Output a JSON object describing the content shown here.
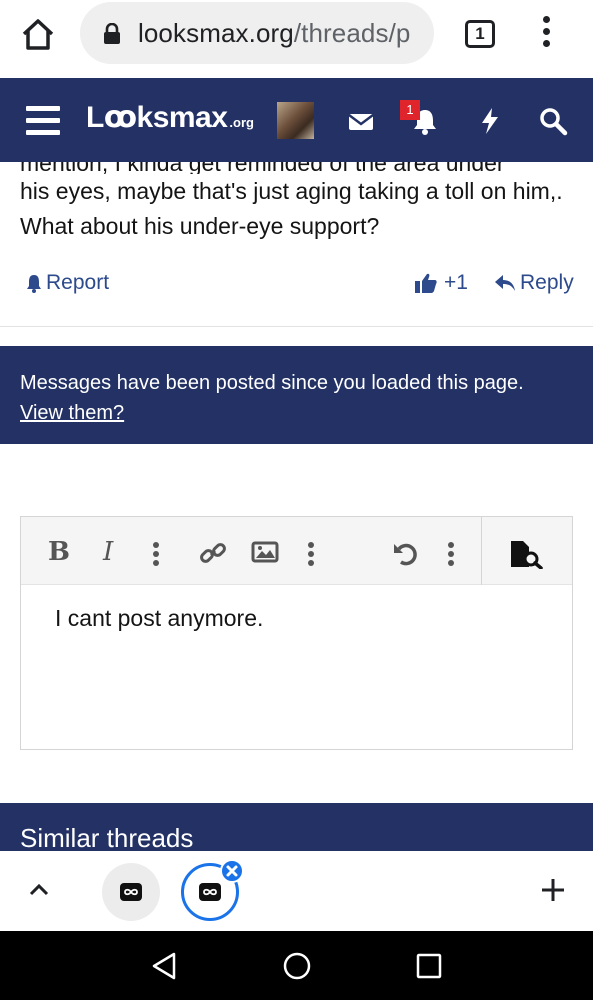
{
  "browser": {
    "url_host": "looksmax.org",
    "url_path": "/threads/p",
    "tab_count": "1",
    "icons": [
      "home-icon",
      "lock-icon",
      "tab-switcher-icon",
      "more-vert-icon"
    ]
  },
  "header": {
    "logo_main": "Lꝏksmax",
    "logo_tld": ".org",
    "notification_count": "1",
    "icons": [
      "menu-icon",
      "avatar",
      "mail-icon",
      "bell-icon",
      "bolt-icon",
      "search-icon"
    ]
  },
  "post": {
    "cut_off_line": "mention, I kinda get reminded of the area under",
    "text": "his eyes, maybe that's just aging taking a toll on him,. What about his under-eye support?",
    "report_label": "Report",
    "like_count": "+1",
    "reply_label": "Reply"
  },
  "notice": {
    "message": "Messages have been posted since you loaded this page.",
    "link": "View them?"
  },
  "editor": {
    "bold": "B",
    "italic": "I",
    "content": "I cant post anymore."
  },
  "similar": {
    "heading": "Similar threads"
  },
  "colors": {
    "header_bg": "#233165",
    "link": "#2c4a8c",
    "badge": "#e0242b",
    "bubble_accent": "#1a73e8"
  }
}
